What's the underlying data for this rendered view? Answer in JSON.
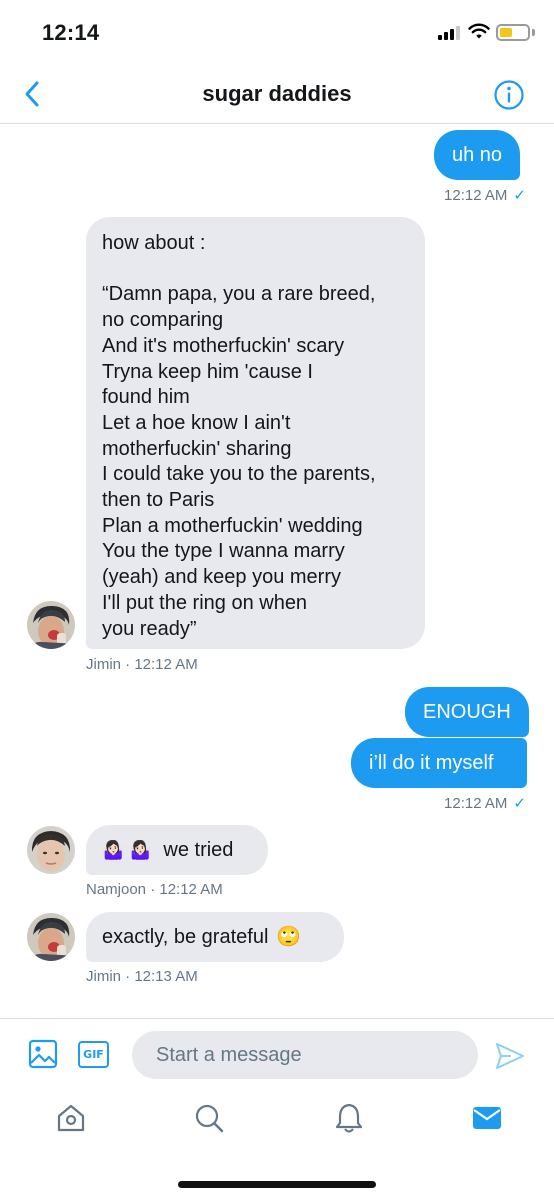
{
  "status_bar": {
    "time": "12:14",
    "battery_color": "#f5c518"
  },
  "header": {
    "title": "sugar daddies",
    "back_icon": "chevron-left-icon",
    "info_icon": "info-icon"
  },
  "messages": [
    {
      "direction": "outgoing",
      "text": "uh no"
    },
    {
      "direction": "outgoing_meta",
      "time": "12:12 AM",
      "status": "✓"
    },
    {
      "direction": "incoming",
      "text": "how about :\n\n “Damn papa, you a rare breed,\nno comparing\nAnd it's motherfuckin' scary\nTryna keep him 'cause I\nfound him\nLet a hoe know I ain't\nmotherfuckin' sharing\nI could take you to the parents,\nthen to Paris\nPlan a motherfuckin' wedding\nYou the type I wanna marry\n(yeah) and keep you merry\nI'll put the ring on when\nyou ready”",
      "sender": "Jimin",
      "time": "12:12 AM",
      "meta": "Jimin · 12:12 AM"
    },
    {
      "direction": "outgoing",
      "text": "ENOUGH"
    },
    {
      "direction": "outgoing",
      "text": "i’ll do it myself"
    },
    {
      "direction": "outgoing_meta",
      "time": "12:12 AM",
      "status": "✓"
    },
    {
      "direction": "incoming",
      "emoji": "🤷🏻‍♀️ 🤷🏻‍♀️",
      "text": "we tried",
      "sender": "Namjoon",
      "time": "12:12 AM",
      "meta": "Namjoon · 12:12 AM"
    },
    {
      "direction": "incoming",
      "text": "exactly,  be grateful",
      "emoji": "🙄",
      "sender": "Jimin",
      "time": "12:13 AM",
      "meta": "Jimin · 12:13 AM"
    }
  ],
  "composer": {
    "placeholder": "Start a message",
    "gif_label": "GIF",
    "image_icon": "image-icon",
    "send_icon": "send-icon"
  },
  "nav": {
    "items": [
      "home-icon",
      "search-icon",
      "notifications-icon",
      "messages-icon"
    ],
    "active": "messages-icon"
  },
  "colors": {
    "accent": "#1d9bf0",
    "incoming_bubble": "#e7e9ef",
    "meta_text": "#657786"
  }
}
